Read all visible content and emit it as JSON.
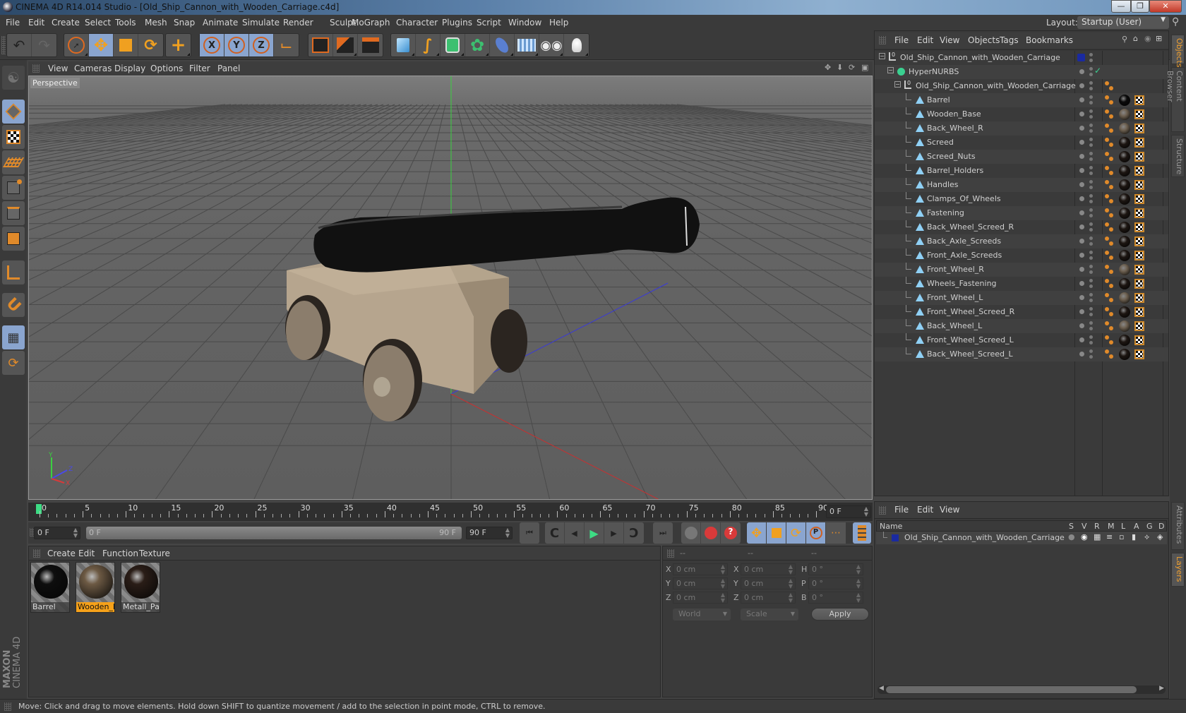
{
  "window": {
    "title": "CINEMA 4D R14.014 Studio - [Old_Ship_Cannon_with_Wooden_Carriage.c4d]",
    "controls": [
      "minimize",
      "maximize",
      "close"
    ]
  },
  "menubar": [
    "File",
    "Edit",
    "Create",
    "Select",
    "Tools",
    "Mesh",
    "Snap",
    "Animate",
    "Simulate",
    "Render",
    "Sculpt",
    "MoGraph",
    "Character",
    "Plugins",
    "Script",
    "Window",
    "Help"
  ],
  "layout": {
    "label": "Layout:",
    "value": "Startup (User)"
  },
  "toolbar": {
    "groups": [
      [
        "undo-icon",
        "redo-icon"
      ],
      [
        "live-selection-icon",
        "move-icon",
        "scale-icon",
        "rotate-icon"
      ],
      [
        "add-object-icon"
      ],
      [
        "x-axis-lock-icon",
        "y-axis-lock-icon",
        "z-axis-lock-icon",
        "coordinate-system-icon"
      ],
      [
        "render-view-icon",
        "render-picture-viewer-icon",
        "render-settings-icon"
      ],
      [
        "cube-primitive-icon",
        "spline-icon",
        "nurbs-icon",
        "array-icon",
        "deformer-icon",
        "floor-icon",
        "camera-icon",
        "light-icon"
      ]
    ]
  },
  "lefttools": [
    "make-editable-icon",
    "model-mode-icon",
    "texture-mode-icon",
    "workplane-mode-icon",
    "points-mode-icon",
    "edges-mode-icon",
    "polygons-mode-icon",
    "axis-mode-icon",
    "magnet-icon",
    "workplane-lock-icon",
    "workplane-snap-icon"
  ],
  "viewport": {
    "menu": [
      "View",
      "Cameras",
      "Display",
      "Options",
      "Filter",
      "Panel"
    ],
    "label": "Perspective",
    "nav_icons": [
      "pan-icon",
      "dolly-icon",
      "orbit-icon",
      "maximize-view-icon"
    ],
    "axes": {
      "x": "X",
      "y": "Y",
      "z": "Z"
    }
  },
  "timeline": {
    "labels": [
      "0",
      "5",
      "10",
      "15",
      "20",
      "25",
      "30",
      "35",
      "40",
      "45",
      "50",
      "55",
      "60",
      "65",
      "70",
      "75",
      "80",
      "85",
      "90"
    ],
    "current_frame": "0 F",
    "start_field": "0 F",
    "range_start": "0 F",
    "range_end": "90 F",
    "end_field": "90 F"
  },
  "transport": {
    "playback": [
      "go-to-start-icon",
      "previous-key-icon",
      "previous-frame-icon",
      "play-icon",
      "next-frame-icon",
      "next-key-icon",
      "go-to-end-icon"
    ],
    "keys": [
      "autokey-icon",
      "record-icon",
      "keyframe-selection-icon"
    ],
    "key_tracks": [
      "move-track-icon",
      "scale-track-icon",
      "rotate-track-icon",
      "parameter-track-icon",
      "point-level-icon"
    ],
    "timeline_icon": "timeline-window-icon"
  },
  "materials": {
    "menu": [
      "Create",
      "Edit",
      "Function",
      "Texture"
    ],
    "items": [
      {
        "name": "Barrel",
        "selected": false,
        "color": "#0e0e0e"
      },
      {
        "name": "Wooden_P",
        "selected": true,
        "color": "#6d5a44"
      },
      {
        "name": "Metall_Part",
        "selected": false,
        "color": "#2a1d17"
      }
    ]
  },
  "coordinates": {
    "headers": [
      "--",
      "--",
      "--"
    ],
    "rows": [
      {
        "a": "X",
        "av": "0 cm",
        "b": "X",
        "bv": "0 cm",
        "c": "H",
        "cv": "0 °"
      },
      {
        "a": "Y",
        "av": "0 cm",
        "b": "Y",
        "bv": "0 cm",
        "c": "P",
        "cv": "0 °"
      },
      {
        "a": "Z",
        "av": "0 cm",
        "b": "Z",
        "bv": "0 cm",
        "c": "B",
        "cv": "0 °"
      }
    ],
    "mode": "World",
    "transform": "Scale",
    "apply": "Apply"
  },
  "objects": {
    "menu": [
      "File",
      "Edit",
      "View",
      "Objects",
      "Tags",
      "Bookmarks"
    ],
    "tree": [
      {
        "name": "Old_Ship_Cannon_with_Wooden_Carriage",
        "level": 0,
        "type": "null",
        "layer": "#1a2aa0"
      },
      {
        "name": "HyperNURBS",
        "level": 1,
        "type": "hypernurbs",
        "check": true
      },
      {
        "name": "Old_Ship_Cannon_with_Wooden_Carriage",
        "level": 2,
        "type": "null",
        "tags": [
          "phong"
        ]
      },
      {
        "name": "Barrel",
        "level": 3,
        "type": "poly",
        "mat": "barrel"
      },
      {
        "name": "Wooden_Base",
        "level": 3,
        "type": "poly",
        "mat": "wood"
      },
      {
        "name": "Back_Wheel_R",
        "level": 3,
        "type": "poly",
        "mat": "wood"
      },
      {
        "name": "Screed",
        "level": 3,
        "type": "poly",
        "mat": "metal"
      },
      {
        "name": "Screed_Nuts",
        "level": 3,
        "type": "poly",
        "mat": "metal"
      },
      {
        "name": "Barrel_Holders",
        "level": 3,
        "type": "poly",
        "mat": "metal"
      },
      {
        "name": "Handles",
        "level": 3,
        "type": "poly",
        "mat": "metal"
      },
      {
        "name": "Clamps_Of_Wheels",
        "level": 3,
        "type": "poly",
        "mat": "metal"
      },
      {
        "name": "Fastening",
        "level": 3,
        "type": "poly",
        "mat": "metal"
      },
      {
        "name": "Back_Wheel_Screed_R",
        "level": 3,
        "type": "poly",
        "mat": "metal"
      },
      {
        "name": "Back_Axle_Screeds",
        "level": 3,
        "type": "poly",
        "mat": "metal"
      },
      {
        "name": "Front_Axle_Screeds",
        "level": 3,
        "type": "poly",
        "mat": "metal"
      },
      {
        "name": "Front_Wheel_R",
        "level": 3,
        "type": "poly",
        "mat": "wood"
      },
      {
        "name": "Wheels_Fastening",
        "level": 3,
        "type": "poly",
        "mat": "metal"
      },
      {
        "name": "Front_Wheel_L",
        "level": 3,
        "type": "poly",
        "mat": "wood"
      },
      {
        "name": "Front_Wheel_Screed_R",
        "level": 3,
        "type": "poly",
        "mat": "metal"
      },
      {
        "name": "Back_Wheel_L",
        "level": 3,
        "type": "poly",
        "mat": "wood"
      },
      {
        "name": "Front_Wheel_Screed_L",
        "level": 3,
        "type": "poly",
        "mat": "metal"
      },
      {
        "name": "Back_Wheel_Screed_L",
        "level": 3,
        "type": "poly",
        "mat": "metal"
      }
    ]
  },
  "sidetabs": {
    "top": [
      {
        "label": "Objects",
        "active": true
      },
      {
        "label": "Content Browser",
        "active": false
      },
      {
        "label": "Structure",
        "active": false
      }
    ],
    "bottom": [
      {
        "label": "Attributes",
        "active": false
      },
      {
        "label": "Layers",
        "active": true
      }
    ]
  },
  "layers": {
    "menu": [
      "File",
      "Edit",
      "View"
    ],
    "columns": [
      "Name",
      "S",
      "V",
      "R",
      "M",
      "L",
      "A",
      "G",
      "D"
    ],
    "rows": [
      {
        "name": "Old_Ship_Cannon_with_Wooden_Carriage",
        "color": "#1a2aa0"
      }
    ]
  },
  "brand": {
    "maxon": "MAXON",
    "product": "CINEMA 4D"
  },
  "status": "Move: Click and drag to move elements. Hold down SHIFT to quantize movement / add to the selection in point mode, CTRL to remove.",
  "colors": {
    "accent": "#f5a11a",
    "active_tool": "#8aa5cf",
    "play": "#3ddc84"
  }
}
